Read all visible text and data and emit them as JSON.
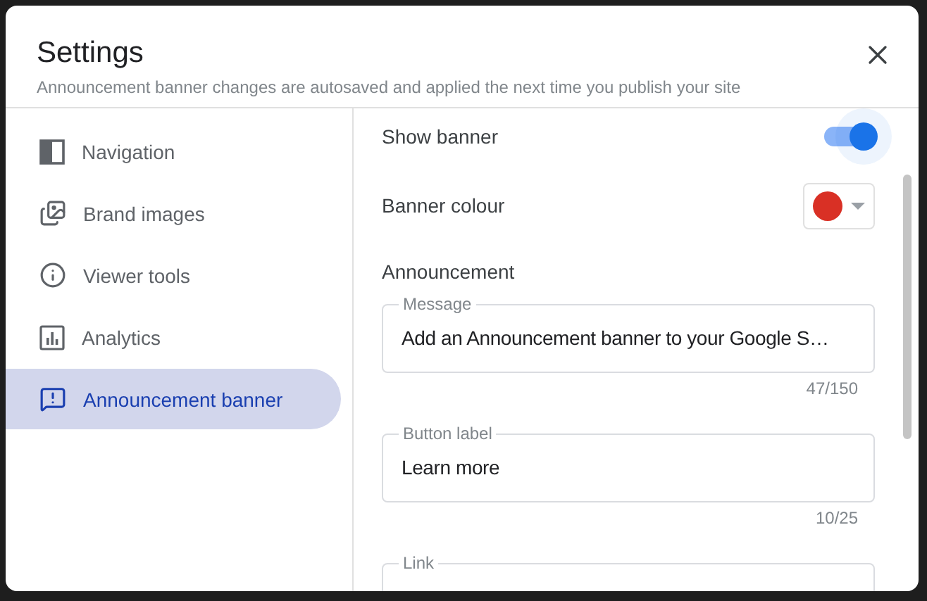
{
  "dialog": {
    "title": "Settings",
    "subtitle": "Announcement banner changes are autosaved and applied the next time you publish your site"
  },
  "sidebar": {
    "items": [
      {
        "kind": "navigation",
        "label": "Navigation",
        "selected": false
      },
      {
        "kind": "images",
        "label": "Brand images",
        "selected": false
      },
      {
        "kind": "info",
        "label": "Viewer tools",
        "selected": false
      },
      {
        "kind": "analytics",
        "label": "Analytics",
        "selected": false
      },
      {
        "kind": "announcement",
        "label": "Announcement banner",
        "selected": true
      }
    ]
  },
  "panel": {
    "show_banner": {
      "label": "Show banner",
      "on": true
    },
    "banner_colour": {
      "label": "Banner colour",
      "color": "#d93025"
    },
    "section_title": "Announcement",
    "fields": [
      {
        "label": "Message",
        "value": "Add an Announcement banner to your Google S…",
        "counter": "47/150"
      },
      {
        "label": "Button label",
        "value": "Learn more",
        "counter": "10/25"
      },
      {
        "label": "Link"
      }
    ]
  }
}
